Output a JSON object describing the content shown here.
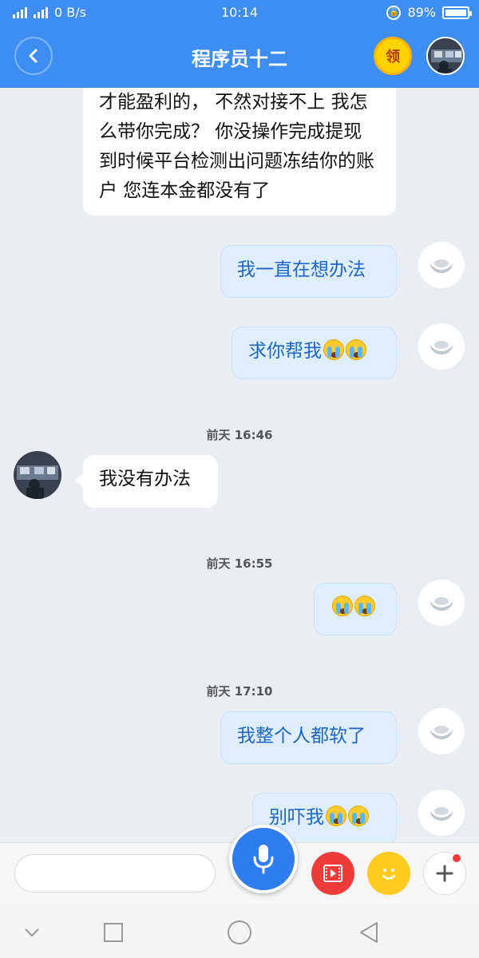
{
  "status": {
    "net_label": "H",
    "net_label2": "2G",
    "speed": "0 B/s",
    "time": "10:14",
    "battery": "89%",
    "battery_level": 0.89
  },
  "header": {
    "title": "程序员十二",
    "ling_label": "领"
  },
  "messages": [
    {
      "side": "left",
      "text": "才能盈利的， 不然对接不上 我怎么带你完成？ 你没操作完成提现 到时候平台检测出问题冻结你的账户 您连本金都没有了"
    },
    {
      "side": "right",
      "text": "我一直在想办法"
    },
    {
      "side": "right",
      "text": "求你帮我",
      "emojis": 2
    },
    {
      "side": "time",
      "text": "前天 16:46"
    },
    {
      "side": "left",
      "text": "我没有办法"
    },
    {
      "side": "time",
      "text": "前天 16:55"
    },
    {
      "side": "right",
      "text": "",
      "emojis": 2
    },
    {
      "side": "time",
      "text": "前天 17:10"
    },
    {
      "side": "right",
      "text": "我整个人都软了"
    },
    {
      "side": "right",
      "text": "别吓我",
      "emojis": 2
    }
  ],
  "input": {
    "placeholder": ""
  },
  "colors": {
    "header_blue": "#3d8ef0",
    "mic_blue": "#2f7cf0",
    "right_bubble_text": "#1d66c9"
  }
}
